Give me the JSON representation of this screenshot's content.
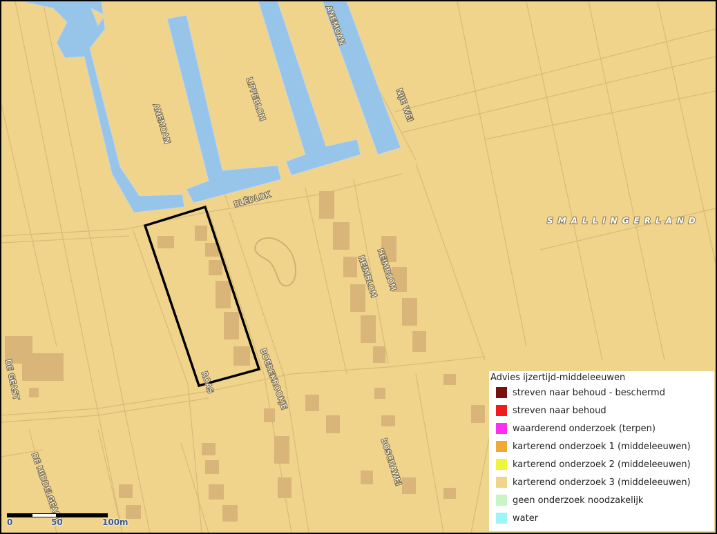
{
  "map": {
    "colors": {
      "background": "#f0d48c",
      "water": "#97c5ea",
      "building": "#d9b57a",
      "road_line": "#d8ba77",
      "plan_boundary": "#000000"
    },
    "street_labels": [
      "ANEMOAN",
      "LIPPEBLOM",
      "ANEMOAN",
      "NIJE WEI",
      "BLÊDLOK",
      "HEIMBLOM",
      "HEIMBLOM",
      "BOEREKROOKJE",
      "ROAS",
      "BOSCHAWEI",
      "DE MIDDELGEAST",
      "DE GEAST"
    ],
    "region_label": "SMALLINGERLAND"
  },
  "legend": {
    "title": "Advies ijzertijd-middeleeuwen",
    "items": [
      {
        "label": "streven naar behoud - beschermd",
        "color": "#7a0f0f"
      },
      {
        "label": "streven naar behoud",
        "color": "#ee1c1c"
      },
      {
        "label": "waarderend onderzoek (terpen)",
        "color": "#ff2ef2"
      },
      {
        "label": "karterend onderzoek 1 (middeleeuwen)",
        "color": "#f0a836"
      },
      {
        "label": "karterend onderzoek 2 (middeleeuwen)",
        "color": "#eef53a"
      },
      {
        "label": "karterend onderzoek 3 (middeleeuwen)",
        "color": "#f0d48c"
      },
      {
        "label": "geen onderzoek noodzakelijk",
        "color": "#c8f5c8"
      },
      {
        "label": "water",
        "color": "#9ef5f5"
      }
    ]
  },
  "scalebar": {
    "labels": [
      "0",
      "50",
      "100m"
    ]
  }
}
